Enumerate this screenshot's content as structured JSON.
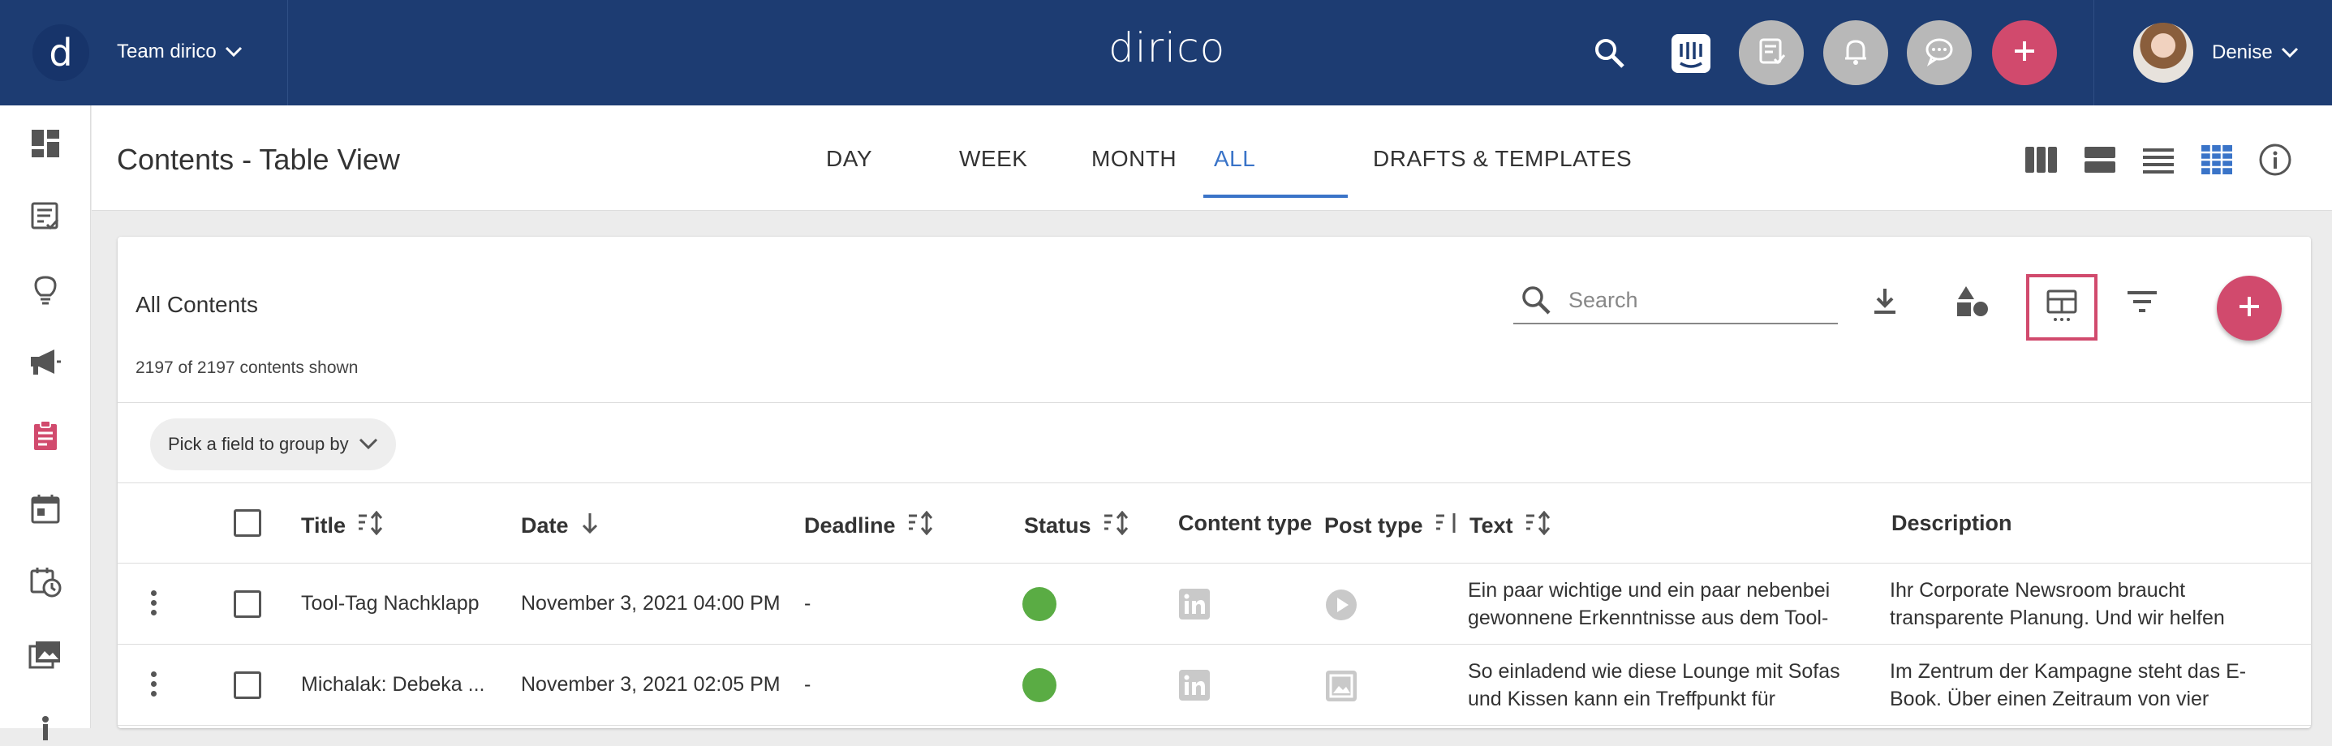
{
  "topbar": {
    "logo_letter": "d",
    "team_name": "Team dirico",
    "brand": "dirico",
    "user_name": "Denise"
  },
  "page": {
    "title": "Contents - Table View",
    "tabs": [
      {
        "label": "DAY"
      },
      {
        "label": "WEEK"
      },
      {
        "label": "MONTH"
      },
      {
        "label": "ALL",
        "active": true
      },
      {
        "label": "DRAFTS & TEMPLATES"
      }
    ]
  },
  "card": {
    "title": "All Contents",
    "count_text": "2197 of 2197 contents shown",
    "search_placeholder": "Search",
    "group_by_label": "Pick a field to group by"
  },
  "table": {
    "columns": [
      "Title",
      "Date",
      "Deadline",
      "Status",
      "Content type",
      "Post type",
      "Text",
      "Description"
    ],
    "rows": [
      {
        "title": "Tool-Tag Nachklapp",
        "date": "November 3, 2021 04:00 PM",
        "deadline": "-",
        "status_color": "#5aac44",
        "content_type_icon": "linkedin-icon",
        "post_type_icon": "video-icon",
        "text": "Ein paar wichtige und ein paar nebenbei gewonnene Erkenntnisse aus dem Tool-Tag...",
        "description": "Ihr Corporate Newsroom braucht transparente Planung. Und wir helfen Ihnen..."
      },
      {
        "title": "Michalak: Debeka ...",
        "date": "November 3, 2021 02:05 PM",
        "deadline": "-",
        "status_color": "#5aac44",
        "content_type_icon": "linkedin-icon",
        "post_type_icon": "image-icon",
        "text": "So einladend wie diese Lounge mit Sofas und Kissen kann ein Treffpunkt für kreative...",
        "description": "Im Zentrum der Kampagne steht das E-Book. Über einen Zeitraum von vier Wochen..."
      }
    ]
  },
  "colors": {
    "topbar": "#1d3c72",
    "accent": "#3a74c8",
    "brand_pink": "#d14a6d",
    "status_green": "#5aac44"
  }
}
